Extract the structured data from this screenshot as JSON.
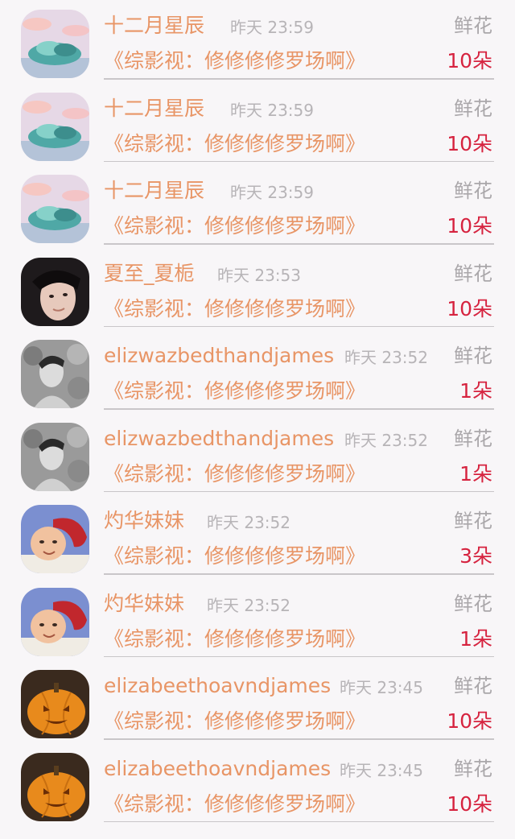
{
  "rows": [
    {
      "name": "十二月星辰",
      "time": "昨天 23:59",
      "gift": "鲜花",
      "title": "《综影视：修修修修罗场啊》",
      "count": "10朵",
      "avatar": "cloud-avatar"
    },
    {
      "name": "十二月星辰",
      "time": "昨天 23:59",
      "gift": "鲜花",
      "title": "《综影视：修修修修罗场啊》",
      "count": "10朵",
      "avatar": "cloud-avatar"
    },
    {
      "name": "十二月星辰",
      "time": "昨天 23:59",
      "gift": "鲜花",
      "title": "《综影视：修修修修罗场啊》",
      "count": "10朵",
      "avatar": "cloud-avatar"
    },
    {
      "name": "夏至_夏栀",
      "time": "昨天 23:53",
      "gift": "鲜花",
      "title": "《综影视：修修修修罗场啊》",
      "count": "10朵",
      "avatar": "man-portrait-avatar"
    },
    {
      "name": "elizwazbedthandjames",
      "time": "昨天 23:52",
      "gift": "鲜花",
      "title": "《综影视：修修修修罗场啊》",
      "count": "1朵",
      "avatar": "bw-portrait-avatar"
    },
    {
      "name": "elizwazbedthandjames",
      "time": "昨天 23:52",
      "gift": "鲜花",
      "title": "《综影视：修修修修罗场啊》",
      "count": "1朵",
      "avatar": "bw-portrait-avatar"
    },
    {
      "name": "灼华妹妹",
      "time": "昨天 23:52",
      "gift": "鲜花",
      "title": "《综影视：修修修修罗场啊》",
      "count": "3朵",
      "avatar": "child-beret-avatar"
    },
    {
      "name": "灼华妹妹",
      "time": "昨天 23:52",
      "gift": "鲜花",
      "title": "《综影视：修修修修罗场啊》",
      "count": "1朵",
      "avatar": "child-beret-avatar"
    },
    {
      "name": "elizabeethoavndjames",
      "time": "昨天 23:45",
      "gift": "鲜花",
      "title": "《综影视：修修修修罗场啊》",
      "count": "10朵",
      "avatar": "pumpkin-avatar"
    },
    {
      "name": "elizabeethoavndjames",
      "time": "昨天 23:45",
      "gift": "鲜花",
      "title": "《综影视：修修修修罗场啊》",
      "count": "10朵",
      "avatar": "pumpkin-avatar"
    }
  ],
  "colors": {
    "name": "#e89566",
    "count": "#d6233f",
    "meta": "#b7b4b7",
    "background": "#f8f6f8"
  }
}
